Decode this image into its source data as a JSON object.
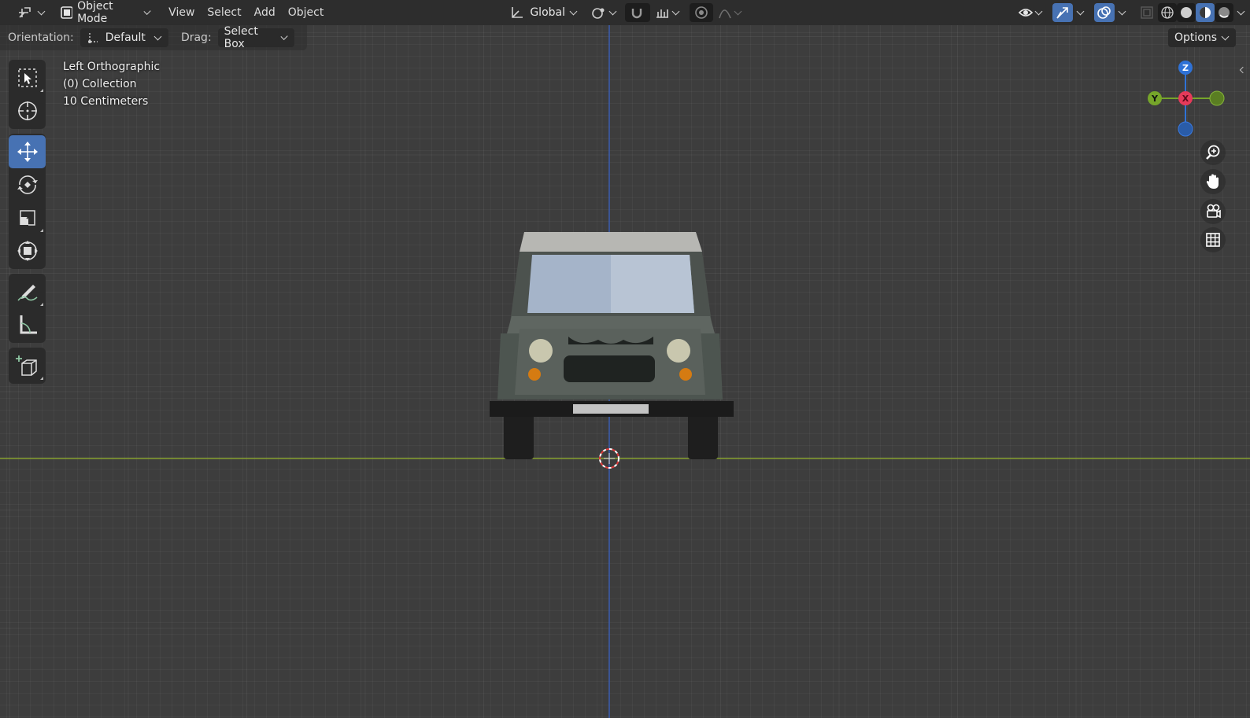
{
  "header": {
    "mode_label": "Object Mode",
    "menu": [
      "View",
      "Select",
      "Add",
      "Object"
    ],
    "transform_orientation": "Global"
  },
  "tool_settings": {
    "orientation_label": "Orientation:",
    "orientation_value": "Default",
    "drag_label": "Drag:",
    "drag_value": "Select Box",
    "options_label": "Options"
  },
  "viewport": {
    "view_name": "Left Orthographic",
    "collection": "(0) Collection",
    "grid_scale": "10 Centimeters"
  },
  "gizmo": {
    "z": "Z",
    "y": "Y",
    "x": "X"
  },
  "colors": {
    "active_tool": "#4772b3",
    "z_axis": "#2f72d6",
    "y_axis": "#76a52a",
    "x_axis": "#e53a5a",
    "floor_line": "#87a02e",
    "vertical_line": "#3a5cb0"
  },
  "tools": [
    "select-box-icon",
    "cursor-icon",
    "move-icon",
    "rotate-icon",
    "scale-icon",
    "transform-icon",
    "annotate-icon",
    "measure-icon",
    "add-cube-icon"
  ],
  "nav_buttons": [
    "zoom-icon",
    "hand-pan-icon",
    "camera-icon",
    "grid-perspective-icon"
  ]
}
